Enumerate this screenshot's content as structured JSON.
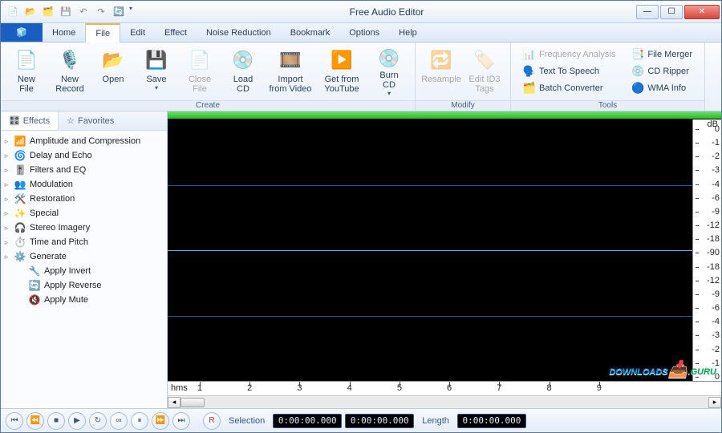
{
  "title": "Free Audio Editor",
  "qat_icons": [
    "doc-icon",
    "open-icon",
    "folder-icon",
    "save-icon",
    "undo-icon",
    "redo-icon",
    "refresh-icon"
  ],
  "tabs": [
    "Home",
    "File",
    "Edit",
    "Effect",
    "Noise Reduction",
    "Bookmark",
    "Options",
    "Help"
  ],
  "active_tab": "File",
  "ribbon": {
    "groups": [
      {
        "label": "Create",
        "big": [
          {
            "id": "new-file",
            "label": "New\nFile",
            "icon": "📄",
            "enabled": true,
            "dropdown": false
          },
          {
            "id": "new-record",
            "label": "New\nRecord",
            "icon": "🎙️",
            "enabled": true,
            "dropdown": false
          },
          {
            "id": "open",
            "label": "Open",
            "icon": "📂",
            "enabled": true,
            "dropdown": false
          },
          {
            "id": "save",
            "label": "Save",
            "icon": "💾",
            "enabled": true,
            "dropdown": true
          },
          {
            "id": "close-file",
            "label": "Close\nFile",
            "icon": "📄",
            "enabled": false,
            "dropdown": false
          },
          {
            "id": "load-cd",
            "label": "Load\nCD",
            "icon": "💿",
            "enabled": true,
            "dropdown": false
          },
          {
            "id": "import-video",
            "label": "Import\nfrom Video",
            "icon": "🎞️",
            "enabled": true,
            "dropdown": false
          },
          {
            "id": "get-youtube",
            "label": "Get from\nYouTube",
            "icon": "▶️",
            "enabled": true,
            "dropdown": false
          },
          {
            "id": "burn-cd",
            "label": "Burn\nCD",
            "icon": "💿",
            "enabled": true,
            "dropdown": true
          }
        ]
      },
      {
        "label": "Modify",
        "big": [
          {
            "id": "resample",
            "label": "Resample",
            "icon": "🔁",
            "enabled": false,
            "dropdown": false
          },
          {
            "id": "edit-id3",
            "label": "Edit ID3\nTags",
            "icon": "🏷️",
            "enabled": false,
            "dropdown": false
          }
        ]
      },
      {
        "label": "Tools",
        "small": [
          {
            "id": "freq-analysis",
            "label": "Frequency Analysis",
            "icon": "📊",
            "enabled": false
          },
          {
            "id": "tts",
            "label": "Text To Speech",
            "icon": "🗣️",
            "enabled": true
          },
          {
            "id": "batch-conv",
            "label": "Batch Converter",
            "icon": "🗂️",
            "enabled": true
          },
          {
            "id": "file-merger",
            "label": "File Merger",
            "icon": "📑",
            "enabled": true
          },
          {
            "id": "cd-ripper",
            "label": "CD Ripper",
            "icon": "💿",
            "enabled": true
          },
          {
            "id": "wma-info",
            "label": "WMA Info",
            "icon": "🔵",
            "enabled": true
          }
        ]
      }
    ]
  },
  "sidebar": {
    "tabs": [
      "Effects",
      "Favorites"
    ],
    "active": "Effects",
    "tree": [
      {
        "label": "Amplitude and Compression",
        "icon": "📶",
        "sub": false
      },
      {
        "label": "Delay and Echo",
        "icon": "🌀",
        "sub": false
      },
      {
        "label": "Filters and EQ",
        "icon": "🎚️",
        "sub": false
      },
      {
        "label": "Modulation",
        "icon": "👥",
        "sub": false
      },
      {
        "label": "Restoration",
        "icon": "🛠️",
        "sub": false
      },
      {
        "label": "Special",
        "icon": "✨",
        "sub": false
      },
      {
        "label": "Stereo Imagery",
        "icon": "🎧",
        "sub": false
      },
      {
        "label": "Time and Pitch",
        "icon": "⏱️",
        "sub": false
      },
      {
        "label": "Generate",
        "icon": "⚙️",
        "sub": false
      },
      {
        "label": "Apply Invert",
        "icon": "🔧",
        "sub": true
      },
      {
        "label": "Apply Reverse",
        "icon": "🔄",
        "sub": true
      },
      {
        "label": "Apply Mute",
        "icon": "🔇",
        "sub": true
      }
    ]
  },
  "db_scale": {
    "unit": "dB",
    "ticks": [
      "0",
      "-1",
      "-2",
      "-3",
      "-4",
      "-6",
      "-9",
      "-12",
      "-18",
      "-90",
      "-18",
      "-12",
      "-9",
      "-6",
      "-4",
      "-3",
      "-2",
      "-1",
      "0"
    ]
  },
  "time_ruler": {
    "unit": "hms",
    "ticks": [
      "1",
      "2",
      "3",
      "4",
      "5",
      "6",
      "7",
      "8",
      "9"
    ]
  },
  "transport": {
    "buttons": [
      "goto-start",
      "step-back",
      "stop",
      "play",
      "replay",
      "loop",
      "pause",
      "step-fwd",
      "goto-end",
      "record"
    ],
    "selection_label": "Selection",
    "selection_start": "0:00:00.000",
    "selection_end": "0:00:00.000",
    "length_label": "Length",
    "length_value": "0:00:00.000"
  },
  "watermark": {
    "a": "DOWNLOADS",
    "b": ".GURU"
  }
}
